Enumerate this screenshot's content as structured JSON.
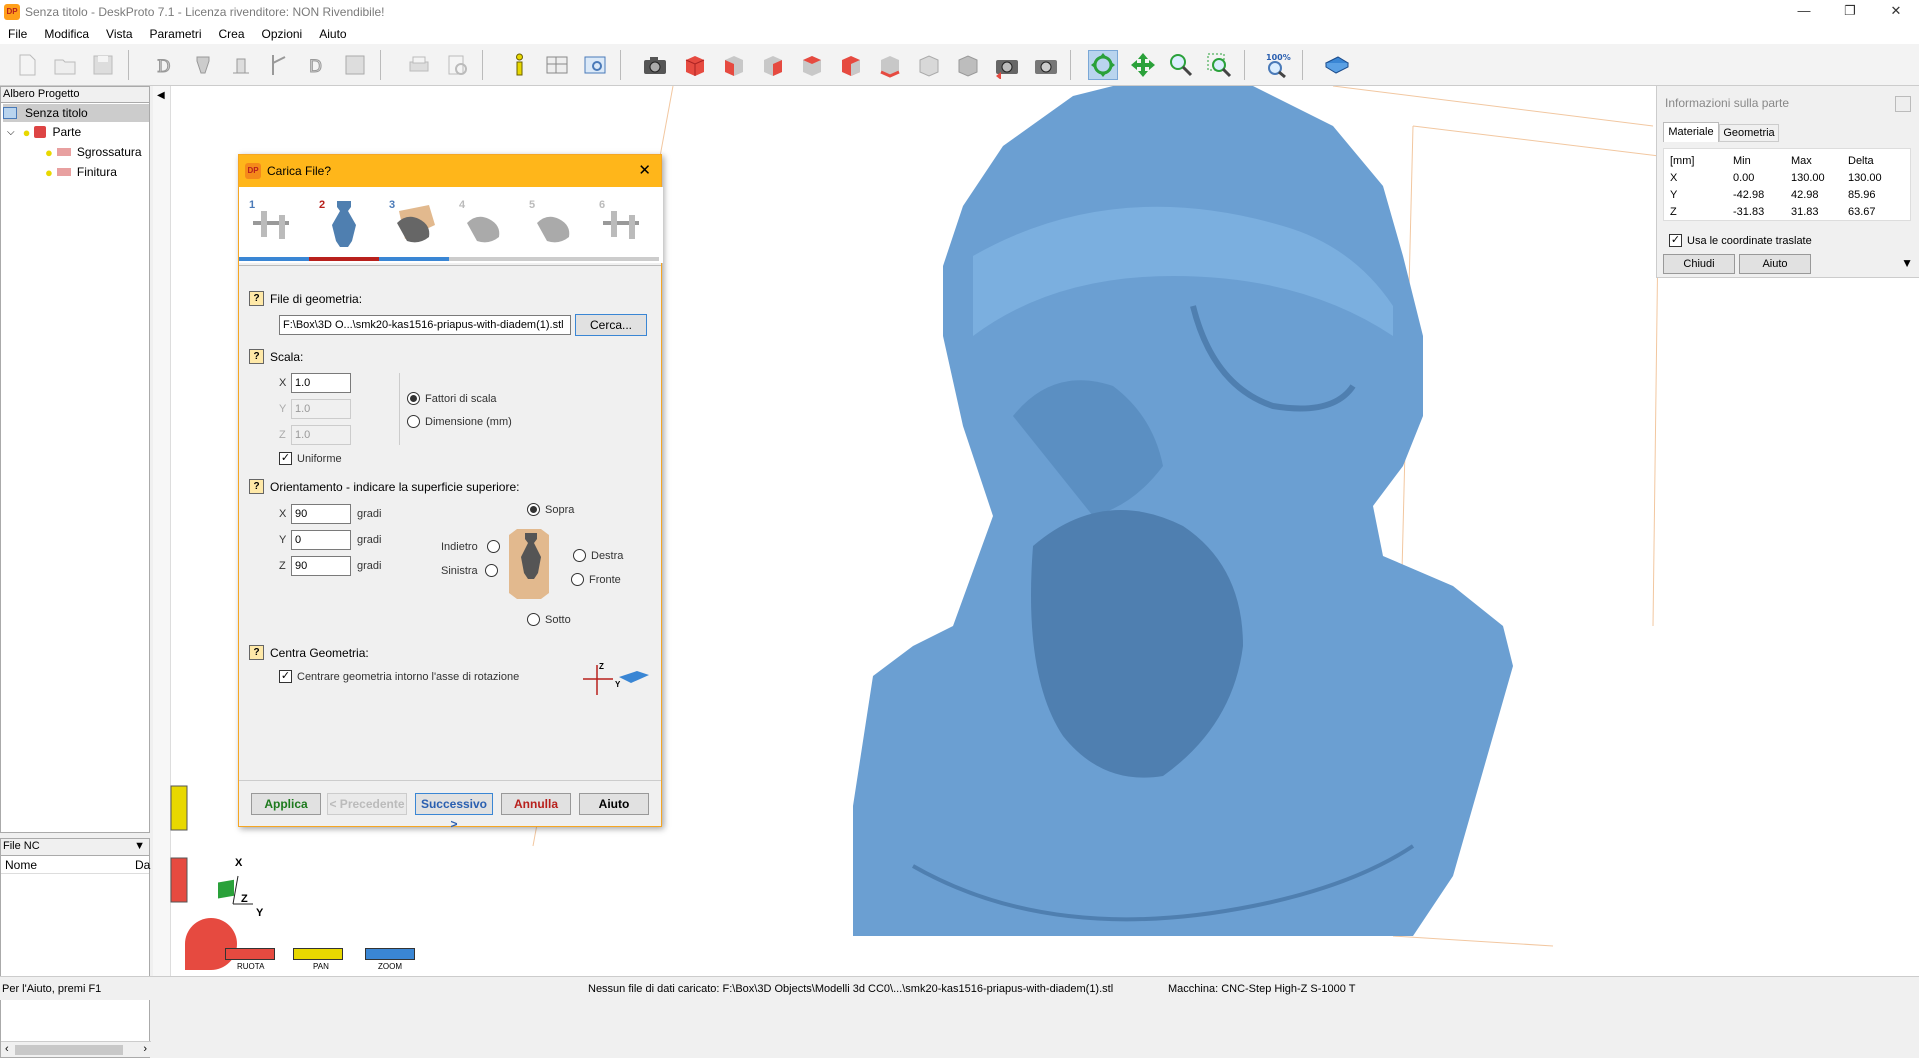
{
  "window": {
    "title": "Senza titolo - DeskProto 7.1 - Licenza rivenditore: NON Rivendibile!",
    "app_icon_text": "DP",
    "minimize": "—",
    "restore": "❐",
    "close": "✕"
  },
  "menu": [
    "File",
    "Modifica",
    "Vista",
    "Parametri",
    "Crea",
    "Opzioni",
    "Aiuto"
  ],
  "project_tree": {
    "header": "Albero Progetto",
    "root": "Senza titolo",
    "part": "Parte",
    "children": [
      "Sgrossatura",
      "Finitura"
    ]
  },
  "nc_panel": {
    "header": "File NC",
    "col_name": "Nome",
    "col_date": "Da"
  },
  "toolbar": {
    "zoom_label": "100%"
  },
  "dialog": {
    "title": "Carica File?",
    "steps": [
      "1",
      "2",
      "3",
      "4",
      "5",
      "6"
    ],
    "geometry_section": "File di geometria:",
    "file_path": "F:\\Box\\3D O...\\smk20-kas1516-priapus-with-diadem(1).stl",
    "browse_button": "Cerca...",
    "scale_section": "Scala:",
    "scale": {
      "x_label": "X",
      "x": "1.0",
      "y_label": "Y",
      "y": "1.0",
      "z_label": "Z",
      "z": "1.0"
    },
    "scale_factors": "Fattori di scala",
    "dimension_mm": "Dimensione (mm)",
    "uniform": "Uniforme",
    "orientation_section": "Orientamento - indicare la superficie superiore:",
    "orient": {
      "x_label": "X",
      "x": "90",
      "y_label": "Y",
      "y": "0",
      "z_label": "Z",
      "z": "90",
      "unit": "gradi"
    },
    "sides": {
      "top": "Sopra",
      "back": "Indietro",
      "left": "Sinistra",
      "right": "Destra",
      "front": "Fronte",
      "bottom": "Sotto"
    },
    "center_section": "Centra Geometria:",
    "center_option": "Centrare geometria intorno l'asse di rotazione",
    "axis_z": "Z",
    "axis_y": "Y",
    "buttons": {
      "apply": "Applica",
      "previous": "< Precedente",
      "next": "Successivo >",
      "cancel": "Annulla",
      "help": "Aiuto"
    }
  },
  "info_panel": {
    "title": "Informazioni sulla parte",
    "tabs": [
      "Materiale",
      "Geometria"
    ],
    "columns": [
      "[mm]",
      "Min",
      "Max",
      "Delta"
    ],
    "rows": [
      [
        "X",
        "0.00",
        "130.00",
        "130.00"
      ],
      [
        "Y",
        "-42.98",
        "42.98",
        "85.96"
      ],
      [
        "Z",
        "-31.83",
        "31.83",
        "63.67"
      ]
    ],
    "use_translated": "Usa le coordinate traslate",
    "close_button": "Chiudi",
    "help_button": "Aiuto"
  },
  "view_controls": {
    "rotate": "RUOTA",
    "pan": "PAN",
    "zoom": "ZOOM"
  },
  "axes": {
    "x": "X",
    "y": "Y",
    "z": "Z"
  },
  "status": {
    "help": "Per l'Aiuto, premi F1",
    "file": "Nessun file di dati caricato: F:\\Box\\3D Objects\\Modelli 3d CC0\\...\\smk20-kas1516-priapus-with-diadem(1).stl",
    "machine": "Macchina: CNC-Step High-Z S-1000 T"
  },
  "colors": {
    "accent_orange": "#ffb61a",
    "model_blue": "#6b9fd2",
    "selection_blue": "#b9d4ee"
  }
}
